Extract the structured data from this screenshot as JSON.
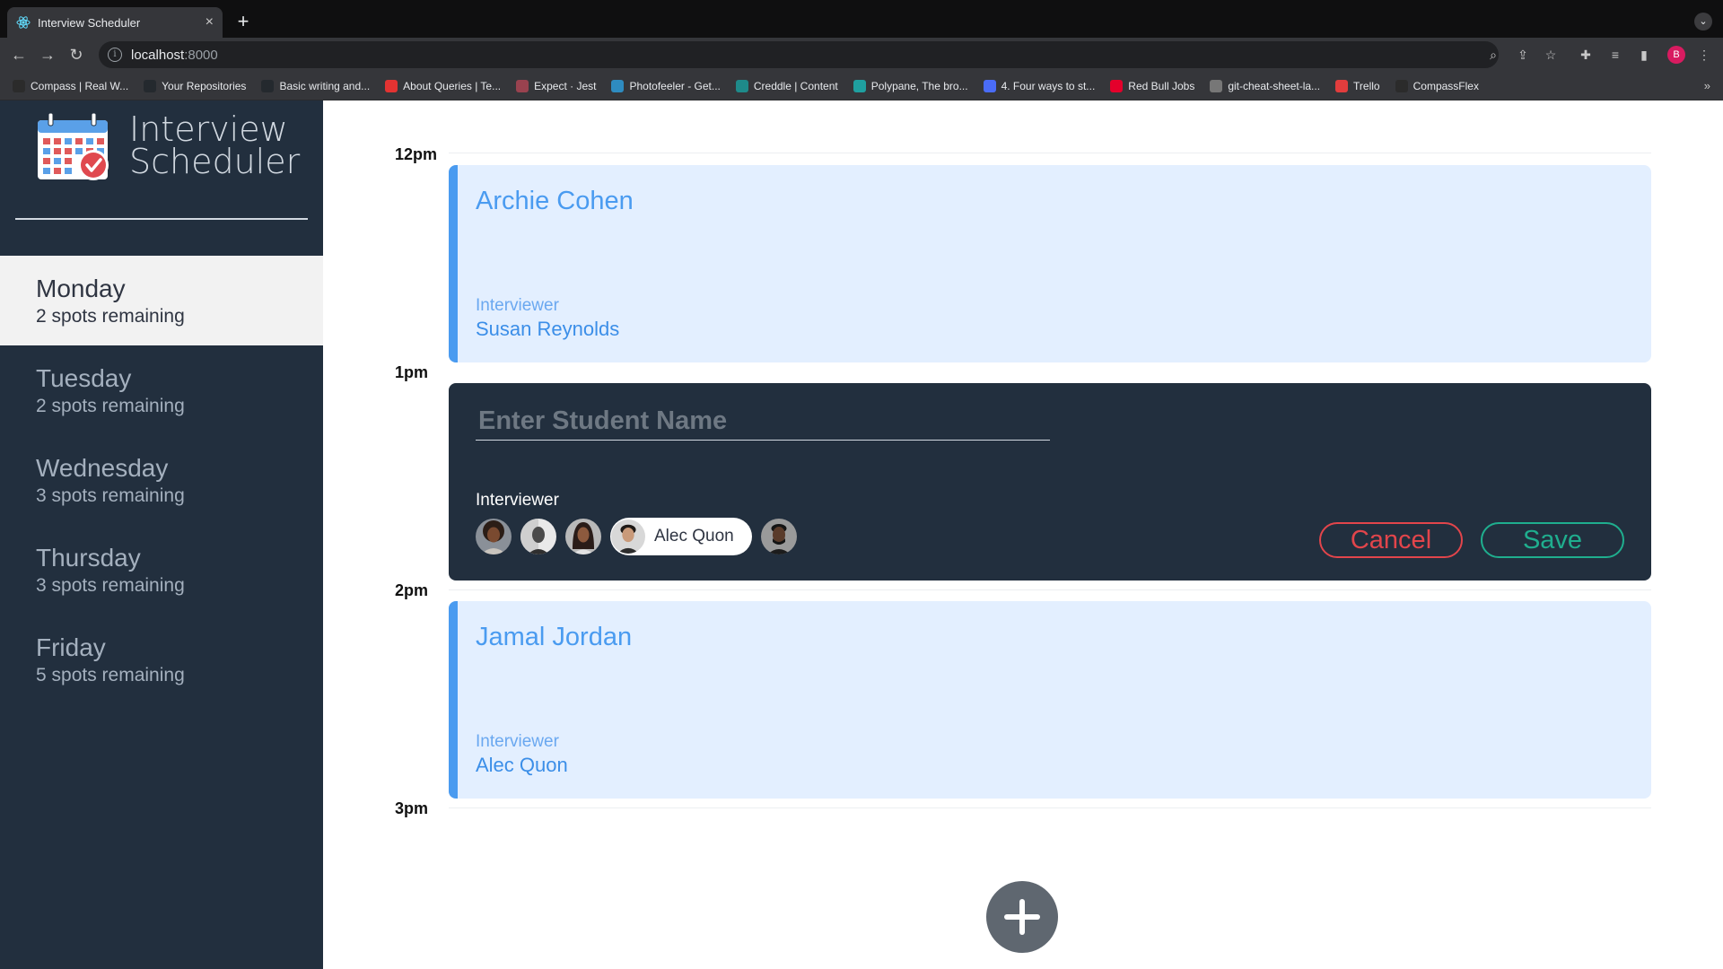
{
  "browser": {
    "tab_title": "Interview Scheduler",
    "tab_close": "×",
    "new_tab": "+",
    "url_host": "localhost",
    "url_port": ":8000",
    "profile_initial": "B",
    "bookmarks": [
      {
        "label": "Compass | Real W...",
        "color": "#2b2b2b"
      },
      {
        "label": "Your Repositories",
        "color": "#24292e"
      },
      {
        "label": "Basic writing and...",
        "color": "#24292e"
      },
      {
        "label": "About Queries | Te...",
        "color": "#e33332"
      },
      {
        "label": "Expect · Jest",
        "color": "#99424f"
      },
      {
        "label": "Photofeeler - Get...",
        "color": "#2e8bc0"
      },
      {
        "label": "Creddle | Content",
        "color": "#1e8a8a"
      },
      {
        "label": "Polypane, The bro...",
        "color": "#1fa0a0"
      },
      {
        "label": "4. Four ways to st...",
        "color": "#4a6cf7"
      },
      {
        "label": "Red Bull Jobs",
        "color": "#e4002b"
      },
      {
        "label": "git-cheat-sheet-la...",
        "color": "#777777"
      },
      {
        "label": "Trello",
        "color": "#e23d3d"
      },
      {
        "label": "CompassFlex",
        "color": "#2b2b2b"
      }
    ],
    "bookmarks_more": "»"
  },
  "sidebar": {
    "brand_line1": "Interview",
    "brand_line2": "Scheduler",
    "days": [
      {
        "name": "Monday",
        "spots": "2 spots remaining",
        "selected": true
      },
      {
        "name": "Tuesday",
        "spots": "2 spots remaining",
        "selected": false
      },
      {
        "name": "Wednesday",
        "spots": "3 spots remaining",
        "selected": false
      },
      {
        "name": "Thursday",
        "spots": "3 spots remaining",
        "selected": false
      },
      {
        "name": "Friday",
        "spots": "5 spots remaining",
        "selected": false
      }
    ]
  },
  "schedule": {
    "times": [
      "12pm",
      "1pm",
      "2pm",
      "3pm"
    ],
    "appointments": [
      {
        "student": "Archie Cohen",
        "interviewer_label": "Interviewer",
        "interviewer": "Susan Reynolds"
      },
      {
        "student": "Jamal Jordan",
        "interviewer_label": "Interviewer",
        "interviewer": "Alec Quon"
      }
    ],
    "form": {
      "placeholder": "Enter Student Name",
      "value": "",
      "interviewer_label": "Interviewer",
      "selected_interviewer": "Alec Quon",
      "cancel_label": "Cancel",
      "save_label": "Save"
    }
  },
  "colors": {
    "sidebar_bg": "#222f3e",
    "appt_bg": "#e3efff",
    "accent_blue": "#4a9bf0",
    "cancel_red": "#e2454b",
    "save_green": "#1fae8e"
  }
}
